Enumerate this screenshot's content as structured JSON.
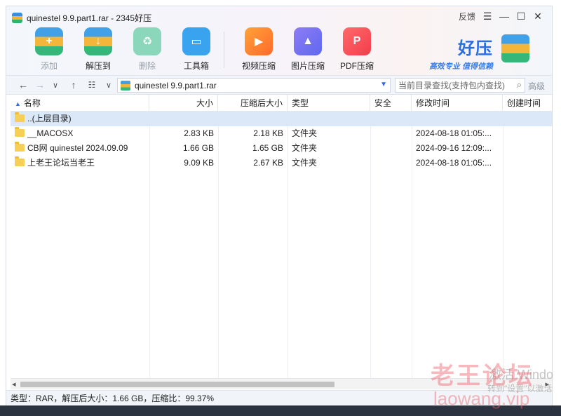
{
  "window": {
    "title": "quinestel 9.9.part1.rar - 2345好压",
    "feedback_label": "反馈",
    "menu_glyph": "☰",
    "min_glyph": "—",
    "max_glyph": "☐",
    "close_glyph": "✕"
  },
  "toolbar": {
    "tools": [
      {
        "label": "添加",
        "icon": "add-archive-icon",
        "enabled": false
      },
      {
        "label": "解压到",
        "icon": "extract-icon",
        "enabled": true
      },
      {
        "label": "删除",
        "icon": "recycle-bin-icon",
        "enabled": false
      },
      {
        "label": "工具箱",
        "icon": "toolbox-icon",
        "enabled": true
      },
      {
        "label": "视频压缩",
        "icon": "video-compress-icon",
        "enabled": true
      },
      {
        "label": "图片压缩",
        "icon": "image-compress-icon",
        "enabled": true
      },
      {
        "label": "PDF压缩",
        "icon": "pdf-compress-icon",
        "enabled": true
      }
    ]
  },
  "brand": {
    "name": "好压",
    "slogan": "高效专业  值得信赖"
  },
  "navbar": {
    "path": "quinestel 9.9.part1.rar",
    "search_placeholder": "当前目录查找(支持包内查找)",
    "advanced_label": "高级"
  },
  "table": {
    "columns": [
      "名称",
      "大小",
      "压缩后大小",
      "类型",
      "安全",
      "修改时间",
      "创建时间"
    ],
    "rows": [
      {
        "name": "..(上层目录)",
        "size": "",
        "packed": "",
        "type": "",
        "security": "",
        "modified": "",
        "created": "",
        "selected": true
      },
      {
        "name": "__MACOSX",
        "size": "2.83 KB",
        "packed": "2.18 KB",
        "type": "文件夹",
        "security": "",
        "modified": "2024-08-18 01:05:...",
        "created": "",
        "selected": false
      },
      {
        "name": "CB网 quinestel 2024.09.09",
        "size": "1.66 GB",
        "packed": "1.65 GB",
        "type": "文件夹",
        "security": "",
        "modified": "2024-09-16 12:09:...",
        "created": "",
        "selected": false
      },
      {
        "name": "上老王论坛当老王",
        "size": "9.09 KB",
        "packed": "2.67 KB",
        "type": "文件夹",
        "security": "",
        "modified": "2024-08-18 01:05:...",
        "created": "",
        "selected": false
      }
    ]
  },
  "status": {
    "text": "类型：RAR，解压后大小：1.66 GB，压缩比：99.37%"
  },
  "overlays": {
    "watermark_cn": "老王论坛",
    "watermark_en": "laowang.vip",
    "activate_line1": "激活 Windo",
    "activate_line2": "转到\"设置\"以激活"
  },
  "colors": {
    "accent": "#2a6ee0",
    "selection": "#dbe8f7",
    "folder": "#f6cf57"
  }
}
